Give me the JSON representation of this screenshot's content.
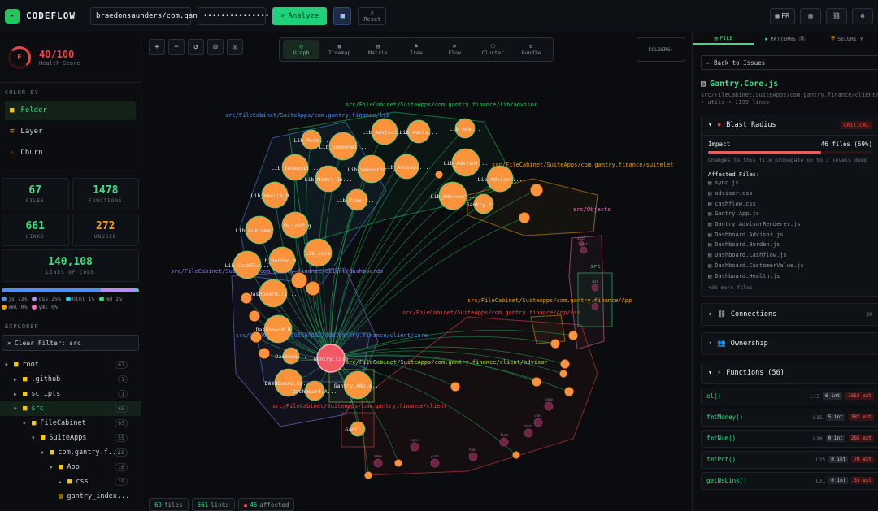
{
  "topbar": {
    "app_name": "CODEFLOW",
    "repo_value": "braedonsaunders/com.gan",
    "token_value": "•••••••••••••••",
    "analyze_label": "Analyze",
    "reset_label": "Reset",
    "pr_label": "PR"
  },
  "health": {
    "grade": "F",
    "score": "40/100",
    "label": "Health Score"
  },
  "color_by": {
    "title": "COLOR BY",
    "items": [
      {
        "label": "Folder",
        "icon": "folder-icon"
      },
      {
        "label": "Layer",
        "icon": "layer-icon"
      },
      {
        "label": "Churn",
        "icon": "flame-icon"
      }
    ]
  },
  "stats": {
    "files": {
      "value": "67",
      "label": "FILES"
    },
    "functions": {
      "value": "1478",
      "label": "FUNCTIONS"
    },
    "links": {
      "value": "661",
      "label": "LINKS"
    },
    "unused": {
      "value": "272",
      "label": "UNUSED"
    },
    "loc": {
      "value": "140,108",
      "label": "LINES OF CODE"
    }
  },
  "languages": [
    {
      "label": "js 73%",
      "color": "#4f8ff7",
      "pct": 73
    },
    {
      "label": "css 25%",
      "color": "#b78cf7",
      "pct": 25
    },
    {
      "label": "html 1%",
      "color": "#22d3ee",
      "pct": 1
    },
    {
      "label": "md 1%",
      "color": "#3ddc84",
      "pct": 1
    },
    {
      "label": "xml 0%",
      "color": "#f59e0b",
      "pct": 0
    },
    {
      "label": "yml 0%",
      "color": "#f472b6",
      "pct": 0
    }
  ],
  "explorer": {
    "title": "EXPLORER",
    "filter_label": "Clear Filter: src",
    "tree": [
      {
        "label": "root",
        "count": "67",
        "depth": 0,
        "open": true
      },
      {
        "label": ".github",
        "count": "1",
        "depth": 1,
        "open": false
      },
      {
        "label": "scripts",
        "count": "1",
        "depth": 1,
        "open": false
      },
      {
        "label": "src",
        "count": "65",
        "depth": 1,
        "open": true,
        "active": true
      },
      {
        "label": "FileCabinet",
        "count": "65",
        "depth": 2,
        "open": true
      },
      {
        "label": "SuiteApps",
        "count": "55",
        "depth": 3,
        "open": true
      },
      {
        "label": "com.gantry.f...",
        "count": "55",
        "depth": 4,
        "open": true
      },
      {
        "label": "App",
        "count": "16",
        "depth": 5,
        "open": true
      },
      {
        "label": "css",
        "count": "15",
        "depth": 6,
        "open": false
      },
      {
        "label": "gantry_index...",
        "count": "",
        "depth": 6,
        "open": false,
        "file": true
      }
    ]
  },
  "canvas": {
    "view_tabs": [
      "Graph",
      "Treemap",
      "Matrix",
      "Tree",
      "Flow",
      "Cluster",
      "Bundle"
    ],
    "folders_label": "FOLDERS▸",
    "footer": {
      "files": "60",
      "files_label": "files",
      "links": "661",
      "links_label": "links",
      "affected": "46",
      "affected_label": "affected"
    },
    "clusters": [
      {
        "label": "src/FileCabinet/SuiteApps/com.gantry.finance/lib/advisor",
        "color": "#22c55e"
      },
      {
        "label": "src/FileCabinet/SuiteApps/com.gantry.finance/lib",
        "color": "#4f8ff7"
      },
      {
        "label": "src/FileCabinet/SuiteApps/com.gantry.finance/suitelet",
        "color": "#f59e0b"
      },
      {
        "label": "src/Objects",
        "color": "#f472b6"
      },
      {
        "label": "src/FileCabinet/SuiteApps/com.gantry.finance/client/dashboards",
        "color": "#8b7cf7"
      },
      {
        "label": "src/FileCabinet/SuiteApps/com.gantry.finance/App",
        "color": "#f59e0b"
      },
      {
        "label": "src/FileCabinet/SuiteApps/com.gantry.finance/App/css",
        "color": "#ef4444"
      },
      {
        "label": "src/FileCabinet/SuiteApps/com.gantry.finance/client/core",
        "color": "#4f8ff7"
      },
      {
        "label": "src/FileCabinet/SuiteApps/com.gantry.finance/client/advisor",
        "color": "#a3e635"
      },
      {
        "label": "src/FileCabinet/SuiteApps/com.gantry.finance/client",
        "color": "#ef4444"
      },
      {
        "label": "src",
        "color": "#3ddc84"
      }
    ],
    "nodes": [
      {
        "label": "Gantry.Core",
        "hub": true
      },
      {
        "label": "Lib_Advisor..."
      },
      {
        "label": "Lib_Advis..."
      },
      {
        "label": "Lib_Adv..."
      },
      {
        "label": "Lib_Perm..."
      },
      {
        "label": "Lib_SpendVel..."
      },
      {
        "label": "Lib_Advisor..."
      },
      {
        "label": "Lib_Integrit..."
      },
      {
        "label": "Lib_Model_De..."
      },
      {
        "label": "Lib_VendorPe..."
      },
      {
        "label": "Lib_Advisor..."
      },
      {
        "label": "Lib_Advisor..."
      },
      {
        "label": "Lib_Health_D..."
      },
      {
        "label": "Lib_Time_D..."
      },
      {
        "label": "Lib_Advisor..."
      },
      {
        "label": "Gantry.R..."
      },
      {
        "label": "Lib_Customer..."
      },
      {
        "label": "Lib_Config"
      },
      {
        "label": "Lib_Burden_D..."
      },
      {
        "label": "Lib_Core"
      },
      {
        "label": "Lib_CashFlo..."
      },
      {
        "label": "Dashboard.Ti..."
      },
      {
        "label": "Dashboard.B..."
      },
      {
        "label": "Dashboa..."
      },
      {
        "label": "Dashboard.Ge..."
      },
      {
        "label": "Dashboard.A..."
      },
      {
        "label": "Gantry.Advis..."
      },
      {
        "label": "Gantr..."
      },
      {
        "label": "auth"
      },
      {
        "label": "cust"
      },
      {
        "label": "mat"
      },
      {
        "label": "eu"
      },
      {
        "label": "comp"
      },
      {
        "label": "cont"
      },
      {
        "label": "dash"
      },
      {
        "label": "fina"
      },
      {
        "label": "heal"
      },
      {
        "label": "pins"
      },
      {
        "label": "sync"
      },
      {
        "label": "adva"
      }
    ]
  },
  "right_panel": {
    "tabs": [
      {
        "label": "FILE",
        "icon": "file-icon"
      },
      {
        "label": "PATTERNS",
        "count": "5",
        "icon": "patterns-icon"
      },
      {
        "label": "SECURITY",
        "icon": "shield-icon"
      }
    ],
    "back_label": "← Back to Issues",
    "file_name": "Gantry.Core.js",
    "file_path": "src/FileCabinet/SuiteApps/com.gantry.finance/client/",
    "file_meta": "• utils • 1199 lines",
    "blast": {
      "title": "Blast Radius",
      "severity": "CRITICAL",
      "impact_label": "Impact",
      "impact_value": "46 files (69%)",
      "impact_ratio": 0.69,
      "note": "Changes to this file propagate up to 3 levels deep",
      "affected_title": "Affected Files:",
      "files": [
        "sync.js",
        "advisor.css",
        "cashflow.css",
        "Gantry.App.js",
        "Gantry.AdvisorRenderer.js",
        "Dashboard.Advisor.js",
        "Dashboard.Burden.js",
        "Dashboard.Cashflow.js",
        "Dashboard.CustomerValue.js",
        "Dashboard.Health.js"
      ],
      "more": "+36 more files"
    },
    "connections": {
      "label": "Connections",
      "count": "39"
    },
    "ownership": {
      "label": "Ownership"
    },
    "functions": {
      "label": "Functions (56)",
      "items": [
        {
          "name": "el()",
          "line": "L13",
          "args": "6 int",
          "ext": "1652 ext"
        },
        {
          "name": "fmtMoney()",
          "line": "L15",
          "args": "5 int",
          "ext": "387 ext"
        },
        {
          "name": "fmtNum()",
          "line": "L20",
          "args": "0 int",
          "ext": "265 ext"
        },
        {
          "name": "fmtPct()",
          "line": "L25",
          "args": "0 int",
          "ext": "70 ext"
        },
        {
          "name": "getNsLink()",
          "line": "L31",
          "args": "0 int",
          "ext": "33 ext"
        }
      ]
    }
  }
}
